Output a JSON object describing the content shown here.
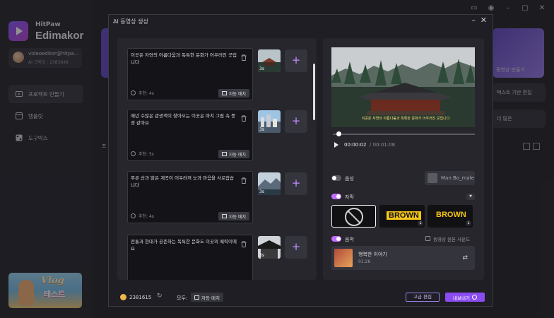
{
  "app": {
    "brand_small": "HitPaw",
    "brand_big": "Edimakor",
    "user": {
      "email": "videoeditor@hitpa...",
      "credit": "AI 크레딧 : 2383648"
    },
    "nav": [
      {
        "label": "프로젝트 만들기",
        "icon": "film-icon"
      },
      {
        "label": "템플릿",
        "icon": "template-icon"
      },
      {
        "label": "도구박스",
        "icon": "toolbox-icon"
      }
    ],
    "banner": {
      "title": "Vlog",
      "subtitle": "테스트"
    },
    "bg": {
      "card_label": "동영상 만들기",
      "btn1": "텍스트 기반 편집",
      "btn2": "더 많은",
      "section_char": "프"
    }
  },
  "dialog": {
    "title": "AI 동영상 생성",
    "scenes": [
      {
        "text": "이곳은 자연의 아름다움과 독특한 문화가 어우러진 곳입니다",
        "duration": "추천: 4s",
        "thumb_dur": "3s",
        "auto_match": "자동 매치"
      },
      {
        "text": "매년 수많은 관광객이 찾아오는 이곳은 마치 그림 속 풍경 같아요",
        "duration": "추천: 5s",
        "thumb_dur": "3s",
        "auto_match": "자동 매치"
      },
      {
        "text": "푸른 산과 맑은 계곡이 어우러져 눈과 마음을 사로잡습니다",
        "duration": "추천: 4s",
        "thumb_dur": "3s",
        "auto_match": "자동 매치"
      },
      {
        "text": "전통과 현대가 공존하는 독특한 문화도 이곳의 매력이에요",
        "duration": "",
        "thumb_dur": "3s",
        "auto_match": ""
      }
    ],
    "add_label": "+",
    "preview": {
      "subtitle": "이곳은 자연의 아름다움과 독특한 문화가 어우러진 곳입니다",
      "time_current": "00:00:02",
      "time_total": "/ 00:01:08"
    },
    "voice": {
      "label": "음성",
      "enabled": false,
      "voice_name": "Man Bo_male"
    },
    "captions": {
      "label": "자막",
      "enabled": true,
      "styles": [
        {
          "name": "none"
        },
        {
          "name": "BROWN"
        },
        {
          "name": "BROWN"
        }
      ]
    },
    "music": {
      "label": "음악",
      "enabled": true,
      "original_sound_label": "동영상 원본 사운드",
      "track_title": "행복한 이야기",
      "track_duration": "01:26"
    },
    "footer": {
      "credits": "2381615",
      "all_label": "모두:",
      "auto_match": "자동 매치",
      "advanced_edit": "고급 편집",
      "export": "내보내기"
    }
  },
  "colors": {
    "accent": "#8a4cf0",
    "toggle_on": "#c26dff",
    "caption_yellow": "#f5c518"
  }
}
